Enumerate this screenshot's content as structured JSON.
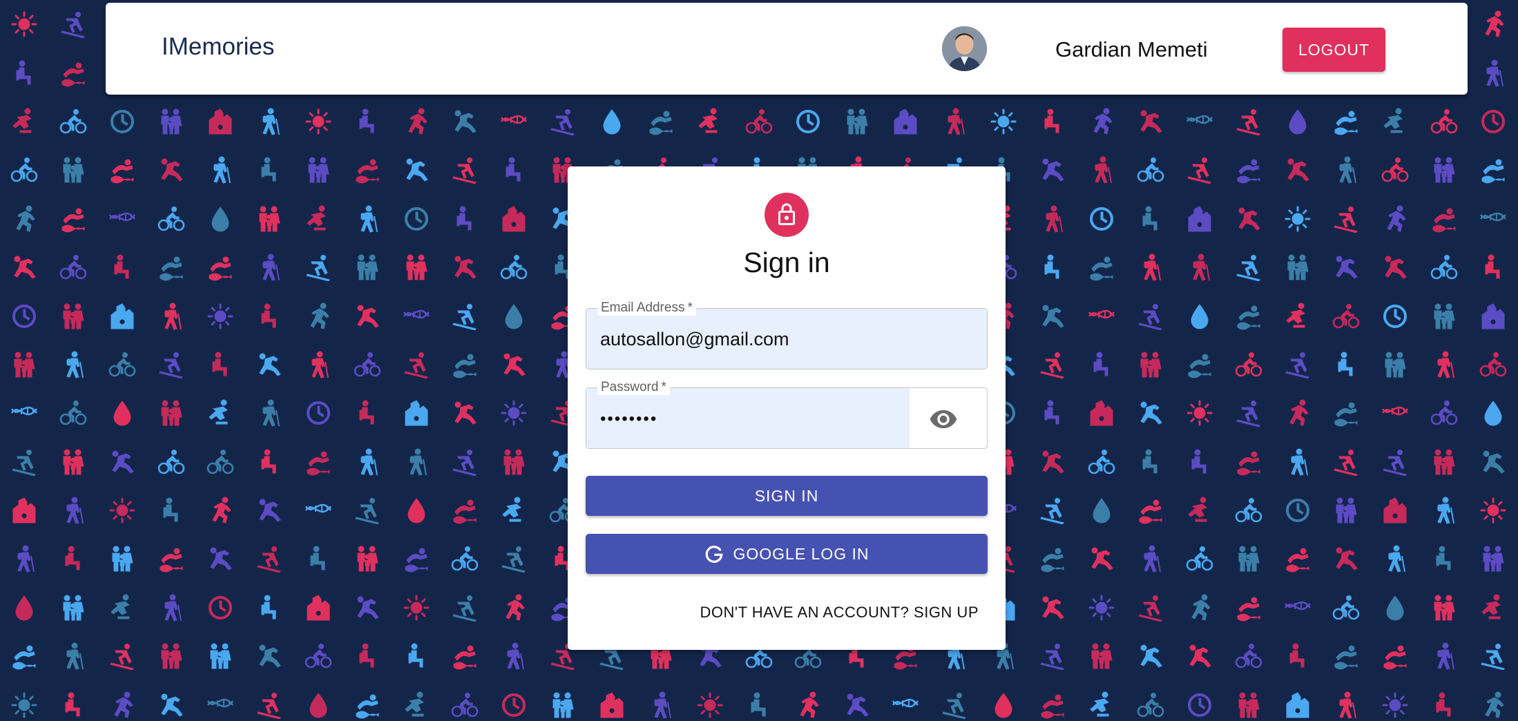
{
  "header": {
    "brand": "IMemories",
    "user_name": "Gardian Memeti",
    "avatar_icon": "user-photo-icon",
    "logout_label": "LOGOUT"
  },
  "signin": {
    "lock_icon": "lock-icon",
    "title": "Sign in",
    "email_label": "Email Address",
    "email_value": "autosallon@gmail.com",
    "password_label": "Password",
    "password_value": "password",
    "required_marker": "*",
    "visibility_icon": "eye-icon",
    "signin_label": "SIGN IN",
    "google_icon": "google-icon",
    "google_label": "GOOGLE LOG IN",
    "signup_link": "DON'T HAVE AN ACCOUNT? SIGN UP"
  },
  "colors": {
    "background": "#14254a",
    "brand_text": "#1b2b4f",
    "accent_red": "#e0315e",
    "primary_blue": "#4652b1",
    "input_fill": "#e8f0fd",
    "pattern_colors": [
      "#e0315e",
      "#4aa8f0",
      "#5b4cc4",
      "#3b7fa8",
      "#c62a5a"
    ]
  },
  "background_pattern": {
    "icons": [
      "sun-icon",
      "cyclist-icon",
      "clock-icon",
      "skier-icon",
      "water-drop-icon",
      "seated-person-icon",
      "runner-icon",
      "family-icon",
      "buildings-icon",
      "swimmer-icon",
      "skater-icon",
      "falling-person-icon",
      "dna-icon",
      "hiker-icon"
    ]
  }
}
